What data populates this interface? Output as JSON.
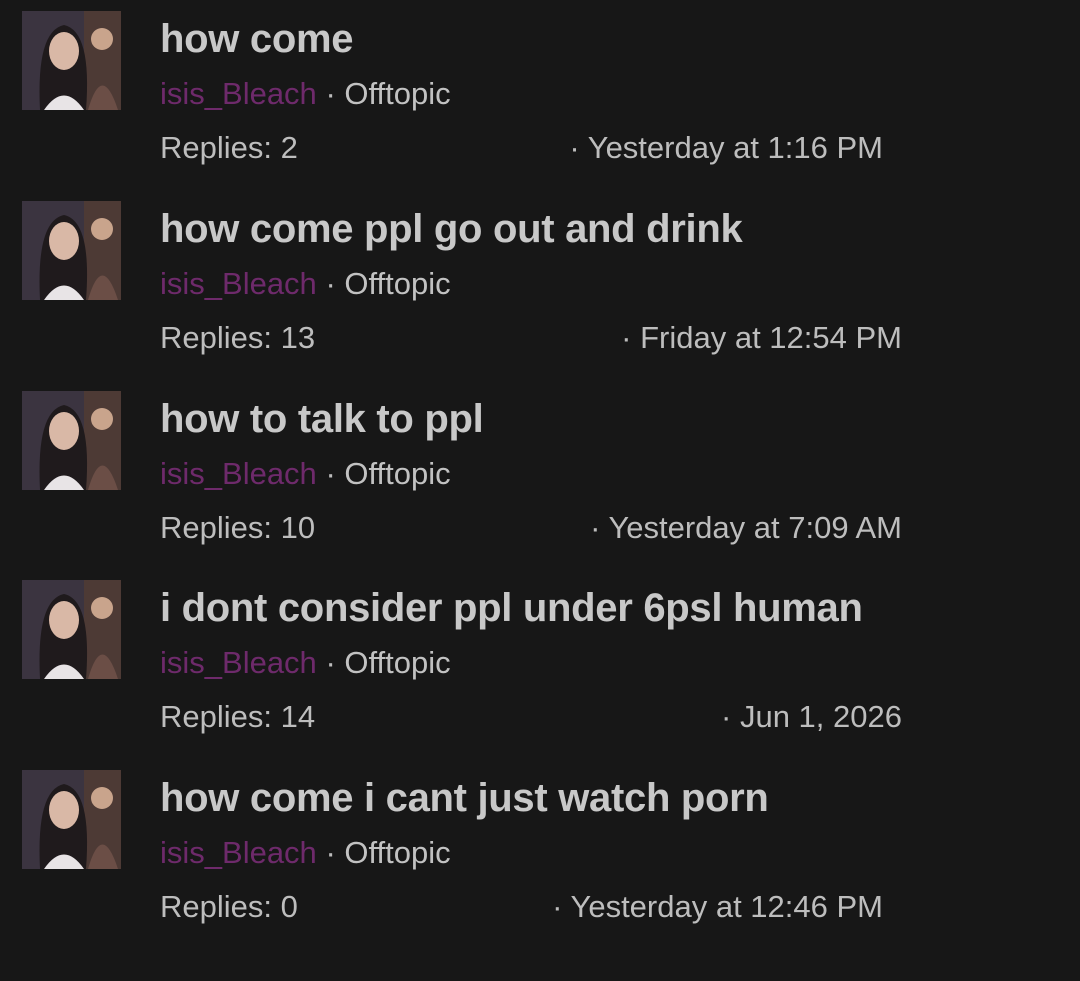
{
  "threads": [
    {
      "title": "how come",
      "author": "isis_Bleach",
      "separator": "·",
      "forum": "Offtopic",
      "replies": "Replies: 2",
      "date": "· Yesterday at 1:16 PM"
    },
    {
      "title": "how come ppl go out and drink",
      "author": "isis_Bleach",
      "separator": "·",
      "forum": "Offtopic",
      "replies": "Replies: 13",
      "date": "· Friday at 12:54 PM"
    },
    {
      "title": "how to talk to ppl",
      "author": "isis_Bleach",
      "separator": "·",
      "forum": "Offtopic",
      "replies": "Replies: 10",
      "date": "· Yesterday at 7:09 AM"
    },
    {
      "title": "i dont consider ppl under 6psl human",
      "author": "isis_Bleach",
      "separator": "·",
      "forum": "Offtopic",
      "replies": "Replies: 14",
      "date": "· Jun 1, 2026"
    },
    {
      "title": "how come i cant just watch porn",
      "author": "isis_Bleach",
      "separator": "·",
      "forum": "Offtopic",
      "replies": "Replies: 0",
      "date": "· Yesterday at 12:46 PM"
    }
  ],
  "colors": {
    "background": "#171717",
    "title": "#c8c8c8",
    "author": "#6e2a6b",
    "meta_text": "#bdbdbd"
  },
  "icons": {
    "avatar": "user-avatar-photo"
  }
}
